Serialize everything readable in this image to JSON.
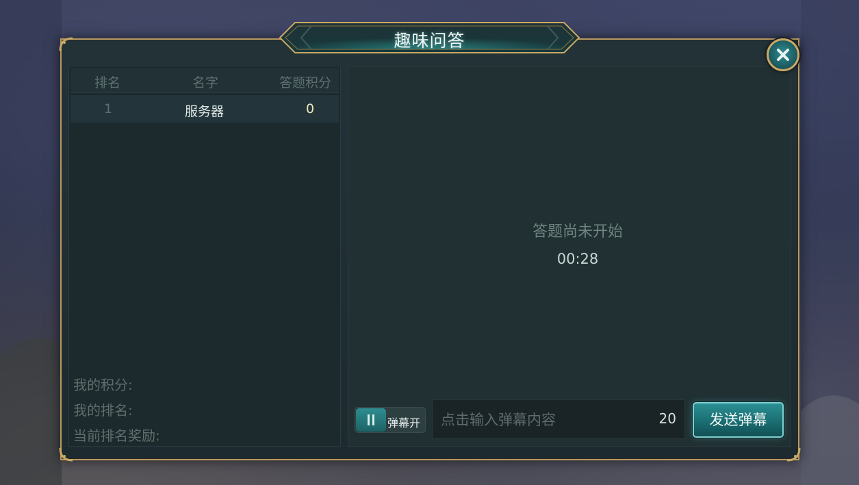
{
  "dialog": {
    "title": "趣味问答",
    "close_icon": "close-icon"
  },
  "leaderboard": {
    "headers": {
      "rank": "排名",
      "name": "名字",
      "score": "答题积分"
    },
    "rows": [
      {
        "rank": "1",
        "name": "服务器",
        "score": "0"
      }
    ]
  },
  "my_info": {
    "my_score_label": "我的积分:",
    "my_rank_label": "我的排名:",
    "current_reward_label": "当前排名奖励:"
  },
  "quiz": {
    "status": "答题尚未开始",
    "countdown": "00:28"
  },
  "danmu": {
    "toggle_label": "弹幕开",
    "toggle_icon": "pause-icon",
    "input_placeholder": "点击输入弹幕内容",
    "char_limit": "20",
    "send_label": "发送弹幕"
  },
  "colors": {
    "frame_gold": "#b69a62",
    "accent_teal": "#2b8f93",
    "panel_bg": "#1d2b30"
  }
}
